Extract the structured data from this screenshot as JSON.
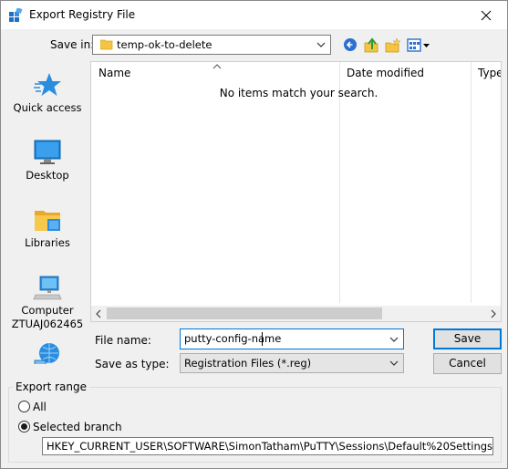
{
  "window": {
    "title": "Export Registry File",
    "icon": "regedit-icon",
    "close_icon": "close-icon"
  },
  "save_in": {
    "label": "Save in:",
    "value": "temp-ok-to-delete",
    "icon": "folder-icon"
  },
  "toolbar": {
    "icons": [
      "back-icon",
      "up-folder-icon",
      "new-folder-icon",
      "view-menu-icon"
    ]
  },
  "places": [
    {
      "label": "Quick access",
      "icon": "star-icon"
    },
    {
      "label": "Desktop",
      "icon": "desktop-icon"
    },
    {
      "label": "Libraries",
      "icon": "libraries-icon"
    },
    {
      "label": "Computer",
      "label2": "ZTUAJ062465",
      "icon": "computer-icon"
    },
    {
      "label": "",
      "icon": "network-icon"
    }
  ],
  "file_list": {
    "columns": [
      "Name",
      "Date modified",
      "Type"
    ],
    "empty_message": "No items match your search."
  },
  "file_name": {
    "label": "File name:",
    "value": "putty-config-name"
  },
  "save_as_type": {
    "label": "Save as type:",
    "value": "Registration Files (*.reg)"
  },
  "buttons": {
    "save": "Save",
    "cancel": "Cancel"
  },
  "export_range": {
    "label": "Export range",
    "options": [
      {
        "label": "All",
        "checked": false
      },
      {
        "label": "Selected branch",
        "checked": true
      }
    ],
    "branch_path": "HKEY_CURRENT_USER\\SOFTWARE\\SimonTatham\\PuTTY\\Sessions\\Default%20Settings"
  },
  "colors": {
    "accent": "#0078d7",
    "dialog_bg": "#f0f0f0"
  }
}
